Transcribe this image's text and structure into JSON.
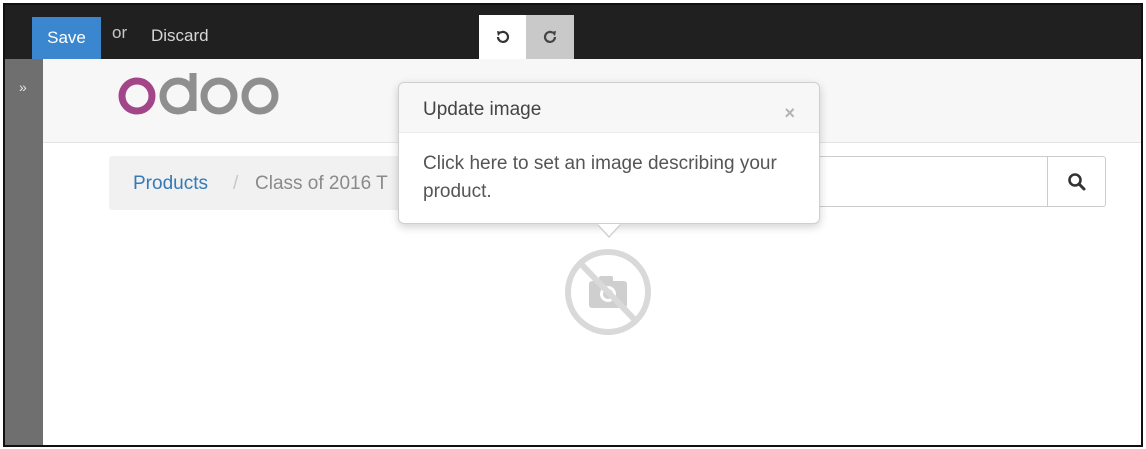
{
  "toolbar": {
    "save_label": "Save",
    "or_label": "or",
    "discard_label": "Discard",
    "undo_icon": "undo-icon",
    "redo_icon": "redo-icon"
  },
  "sidebar": {
    "toggle_label": "»"
  },
  "logo": {
    "text": "odoo",
    "colors": [
      "#a24689",
      "#8f8f8f",
      "#8f8f8f",
      "#8f8f8f"
    ]
  },
  "breadcrumb": {
    "items": [
      {
        "label": "Products"
      },
      {
        "label": "Class of 2016 T"
      }
    ],
    "separator": "/"
  },
  "search": {
    "icon": "search-icon",
    "placeholder": ""
  },
  "popover": {
    "title": "Update image",
    "close_label": "×",
    "body": "Click here to set an image describing your product."
  },
  "image_placeholder": {
    "icon": "no-camera-icon"
  },
  "colors": {
    "primary": "#3a87cf",
    "link": "#337ab7",
    "toolbar_bg": "#202020",
    "sidebar_bg": "#6f6f6f"
  }
}
